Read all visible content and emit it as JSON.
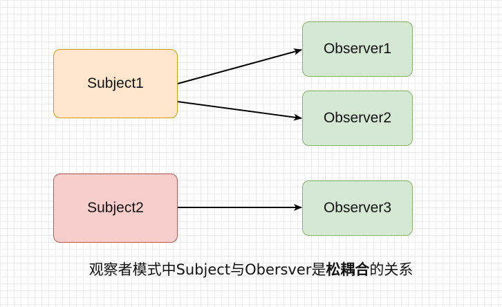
{
  "nodes": {
    "subject1": {
      "label": "Subject1",
      "fill": "#ffe6cc",
      "stroke": "#d79b00"
    },
    "subject2": {
      "label": "Subject2",
      "fill": "#f8cecc",
      "stroke": "#b85450"
    },
    "observer1": {
      "label": "Observer1",
      "fill": "#d5e8d4",
      "stroke": "#82b366"
    },
    "observer2": {
      "label": "Observer2",
      "fill": "#d5e8d4",
      "stroke": "#82b366"
    },
    "observer3": {
      "label": "Observer3",
      "fill": "#d5e8d4",
      "stroke": "#82b366"
    }
  },
  "edges": [
    {
      "from": "subject1",
      "to": "observer1"
    },
    {
      "from": "subject1",
      "to": "observer2"
    },
    {
      "from": "subject2",
      "to": "observer3"
    }
  ],
  "caption": {
    "before": "观察者模式中Subject与Obersver是",
    "bold": "松耦合",
    "after": "的关系"
  }
}
